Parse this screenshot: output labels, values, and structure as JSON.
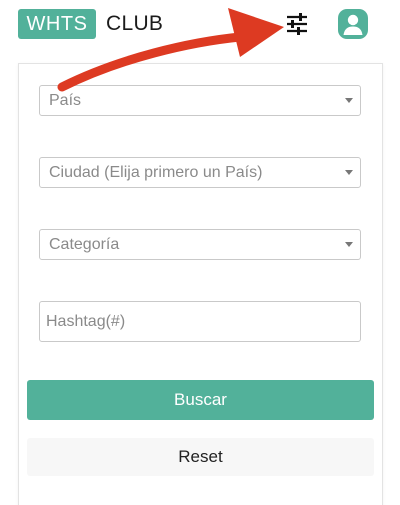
{
  "header": {
    "brand_badge": "WHTS",
    "brand_text": "CLUB",
    "filter_icon": "sliders-icon",
    "profile_icon": "user-circle-icon"
  },
  "form": {
    "country_select": "País",
    "city_select": "Ciudad (Elija primero un País)",
    "category_select": "Categoría",
    "hashtag_placeholder": "Hashtag(#)",
    "search_label": "Buscar",
    "reset_label": "Reset"
  },
  "colors": {
    "accent": "#52b19a",
    "annotation_arrow": "#dd3a22",
    "reset_bg": "#f7f7f7"
  }
}
